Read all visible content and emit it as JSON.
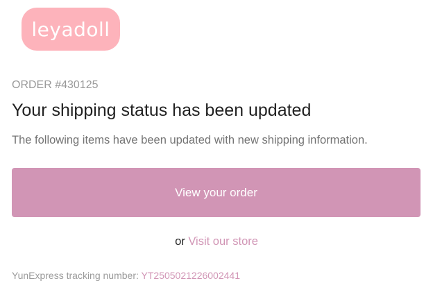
{
  "logo": {
    "text": "leyadoll",
    "background": "#fdb3bb"
  },
  "order": {
    "number_label": "ORDER #430125"
  },
  "headline": "Your shipping status has been updated",
  "subtext": "The following items have been updated with new shipping information.",
  "cta": {
    "view_order_label": "View your order",
    "background": "#d195b5"
  },
  "store": {
    "prefix": "or",
    "link_label": "Visit our store"
  },
  "tracking": {
    "label": "YunExpress tracking number:",
    "number": "YT2505021226002441"
  },
  "colors": {
    "accent": "#d195b5",
    "muted_text": "#9a9a9a",
    "body_text": "#747474",
    "heading_text": "#222222"
  }
}
